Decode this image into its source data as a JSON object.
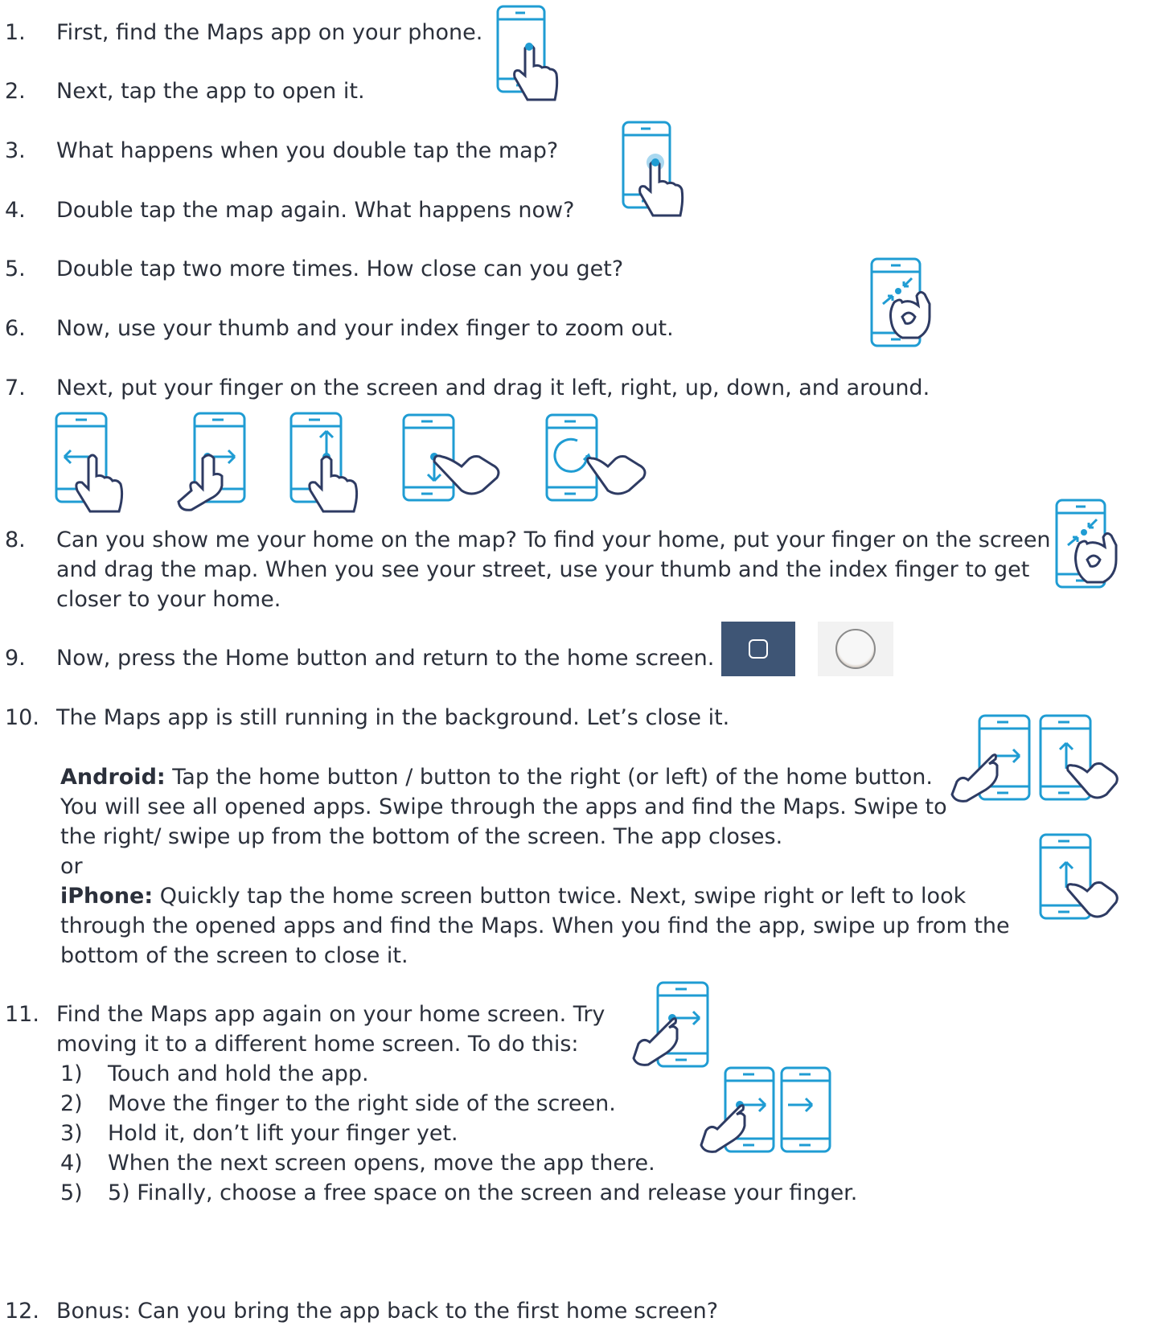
{
  "steps": [
    {
      "num": "1.",
      "text": "First, find the Maps app on your phone."
    },
    {
      "num": "2.",
      "text": "Next, tap the app to open it."
    },
    {
      "num": "3.",
      "text": "What happens when you double tap the map?"
    },
    {
      "num": "4.",
      "text": "Double tap the map again. What happens now?"
    },
    {
      "num": "5.",
      "text": "Double tap two more times. How close can you get?"
    },
    {
      "num": "6.",
      "text": "Now, use your thumb and your index finger to zoom out."
    },
    {
      "num": "7.",
      "text": "Next, put your finger on the screen and drag it left, right, up, down, and around."
    },
    {
      "num": "8.",
      "lines": [
        "Can you show me your home on the map? To find your home, put your finger on the screen",
        "and drag the map. When you see your street, use your thumb and the index finger to get",
        "closer to your home."
      ]
    },
    {
      "num": "9.",
      "text": "Now, press the Home button and return to the home screen."
    },
    {
      "num": "10.",
      "text": "The Maps app is still running in the background. Let’s close it."
    },
    {
      "num": "11.",
      "lines": [
        "Find the Maps app again on your home screen. Try",
        "moving it to a different home screen. To do this:"
      ]
    },
    {
      "num": "12.",
      "text": "Bonus: Can you bring the app back to the first home screen?"
    }
  ],
  "android": {
    "label": "Android:",
    "line1": " Tap the home button / button to the right (or left) of the home button.",
    "line2": "You will see all opened apps. Swipe through the apps and find the Maps. Swipe to",
    "line3": "the right/ swipe up from the bottom of the screen. The app closes."
  },
  "or_text": "or",
  "iphone": {
    "label": "iPhone:",
    "line1": " Quickly tap the home screen button twice. Next, swipe right or left to look",
    "line2": "through the opened apps and find the Maps. When you find the app, swipe up from the",
    "line3": "bottom of the screen to close it."
  },
  "substeps": [
    {
      "num": "1)",
      "text": "Touch and hold the app."
    },
    {
      "num": "2)",
      "text": "Move the finger to the right side of the screen."
    },
    {
      "num": "3)",
      "text": "Hold it, don’t lift your finger yet."
    },
    {
      "num": "4)",
      "text": "When the next screen opens, move the app there."
    },
    {
      "num": "5)",
      "text": "5)   Finally, choose a free space on the screen and release your finger."
    }
  ],
  "colors": {
    "phone_outline": "#1f9cd3",
    "hand_outline": "#2e3b63",
    "text": "#2b303b"
  }
}
